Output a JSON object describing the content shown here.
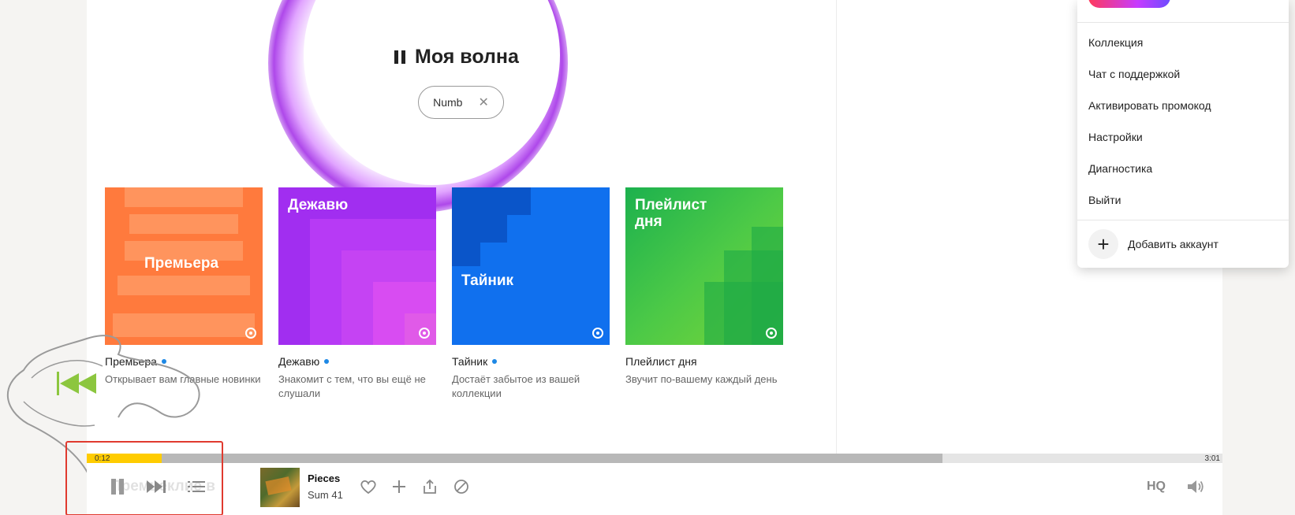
{
  "wave": {
    "title": "Моя волна",
    "chip": "Numb"
  },
  "cards": [
    {
      "cover_title": "Премьера",
      "name": "Премьера",
      "desc": "Открывает вам главные новинки"
    },
    {
      "cover_title": "Дежавю",
      "name": "Дежавю",
      "desc": "Знакомит с тем, что вы ещё не слушали"
    },
    {
      "cover_title": "Тайник",
      "name": "Тайник",
      "desc": "Достаёт забытое из вашей коллекции"
    },
    {
      "cover_title": "Плейлист дня",
      "name": "Плейлист дня",
      "desc": "Звучит по-вашему каждый день"
    }
  ],
  "player": {
    "current_time": "0:12",
    "total_time": "3:01",
    "progress_fraction": 0.066,
    "track_title": "Pieces",
    "track_artist": "Sum 41",
    "quality": "HQ",
    "ghost_title": "Премьеклие в"
  },
  "menu": {
    "items": [
      "Коллекция",
      "Чат с поддержкой",
      "Активировать промокод",
      "Настройки",
      "Диагностика",
      "Выйти"
    ],
    "add_account": "Добавить аккаунт"
  },
  "colors": {
    "progress": "#ffcc00",
    "highlight": "#e03a2f",
    "new_dot": "#1e88e5"
  }
}
